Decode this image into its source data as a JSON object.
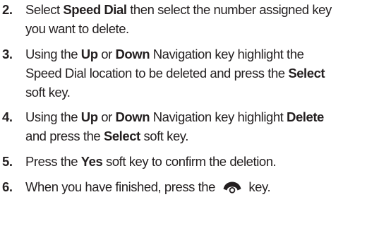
{
  "steps": [
    {
      "number": "2.",
      "lines": [
        [
          {
            "t": "Select ",
            "b": false
          },
          {
            "t": "Speed Dial",
            "b": true
          },
          {
            "t": " then select the number assigned key",
            "b": false
          }
        ],
        [
          {
            "t": "you want to delete.",
            "b": false
          }
        ]
      ]
    },
    {
      "number": "3.",
      "lines": [
        [
          {
            "t": "Using the ",
            "b": false
          },
          {
            "t": "Up",
            "b": true
          },
          {
            "t": " or ",
            "b": false
          },
          {
            "t": "Down",
            "b": true
          },
          {
            "t": " Navigation key highlight the",
            "b": false
          }
        ],
        [
          {
            "t": "Speed Dial location to be deleted and press the ",
            "b": false
          },
          {
            "t": "Select",
            "b": true
          }
        ],
        [
          {
            "t": "soft key.",
            "b": false
          }
        ]
      ]
    },
    {
      "number": "4.",
      "lines": [
        [
          {
            "t": "Using the ",
            "b": false
          },
          {
            "t": "Up",
            "b": true
          },
          {
            "t": " or ",
            "b": false
          },
          {
            "t": "Down",
            "b": true
          },
          {
            "t": " Navigation key highlight ",
            "b": false
          },
          {
            "t": "Delete",
            "b": true
          }
        ],
        [
          {
            "t": "and press the ",
            "b": false
          },
          {
            "t": "Select",
            "b": true
          },
          {
            "t": " soft key.",
            "b": false
          }
        ]
      ]
    },
    {
      "number": "5.",
      "lines": [
        [
          {
            "t": "Press the ",
            "b": false
          },
          {
            "t": "Yes",
            "b": true
          },
          {
            "t": " soft key to confirm the deletion.",
            "b": false
          }
        ]
      ]
    },
    {
      "number": "6.",
      "lines": [
        [
          {
            "t": "When you have finished, press the ",
            "b": false
          },
          {
            "icon": "end-call-key-icon"
          },
          {
            "t": " key.",
            "b": false
          }
        ]
      ]
    }
  ],
  "colors": {
    "text": "#231f20",
    "background": "#ffffff"
  }
}
